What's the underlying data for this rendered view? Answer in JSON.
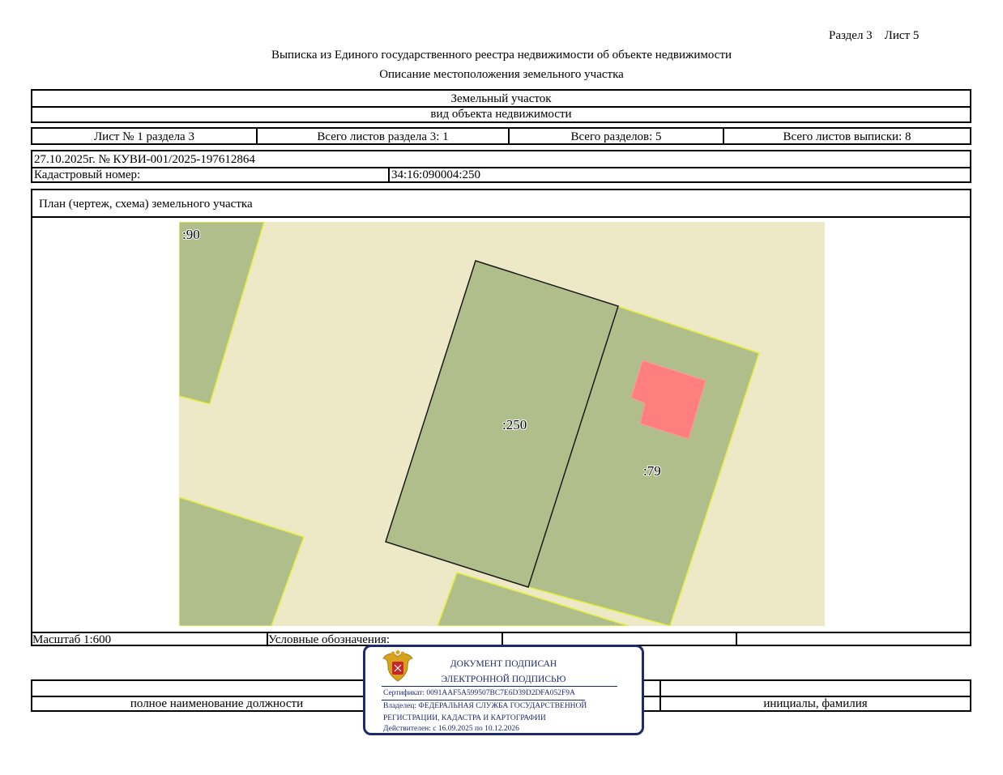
{
  "header": {
    "section_sheet": "Раздел 3    Лист 5",
    "title": "Выписка из Единого государственного реестра недвижимости об объекте недвижимости",
    "subtitle": "Описание местоположения земельного участка"
  },
  "object": {
    "type": "Земельный участок",
    "type_caption": "вид объекта недвижимости"
  },
  "sheets": {
    "sheet": "Лист № 1 раздела 3",
    "sheets_in_section": "Всего листов раздела 3: 1",
    "total_sections": "Всего разделов: 5",
    "total_sheets": "Всего листов выписки: 8"
  },
  "record": {
    "date_number": "27.10.2025г. № КУВИ-001/2025-197612864",
    "cadastral_label": "Кадастровый номер:",
    "cadastral_number": "34:16:090004:250"
  },
  "plan": {
    "title": "План (чертеж, схема) земельного участка",
    "labels": {
      "parcel_90": ":90",
      "parcel_250": ":250",
      "parcel_79": ":79"
    },
    "colors": {
      "background": "#ede9c6",
      "parcel": "#b0be8c",
      "parcel_edge": "#e4ef3c",
      "building": "#ff7f7f"
    }
  },
  "footer": {
    "scale": "Масштаб 1:600",
    "legend": "Условные обозначения:",
    "position_caption": "полное наименование должности",
    "name_caption": "инициалы, фамилия"
  },
  "stamp": {
    "line1": "ДОКУМЕНТ ПОДПИСАН",
    "line2": "ЭЛЕКТРОННОЙ ПОДПИСЬЮ",
    "certificate": "Сертификат: 0091AAF5A599507BC7E6D39D2DFA052F9A",
    "owner1": "Владелец: ФЕДЕРАЛЬНАЯ СЛУЖБА ГОСУДАРСТВЕННОЙ",
    "owner2": "РЕГИСТРАЦИИ, КАДАСТРА И КАРТОГРАФИИ",
    "valid": "Действителен: с 16.09.2025 по 10.12.2026",
    "emblem": "coat-of-arms-icon"
  }
}
